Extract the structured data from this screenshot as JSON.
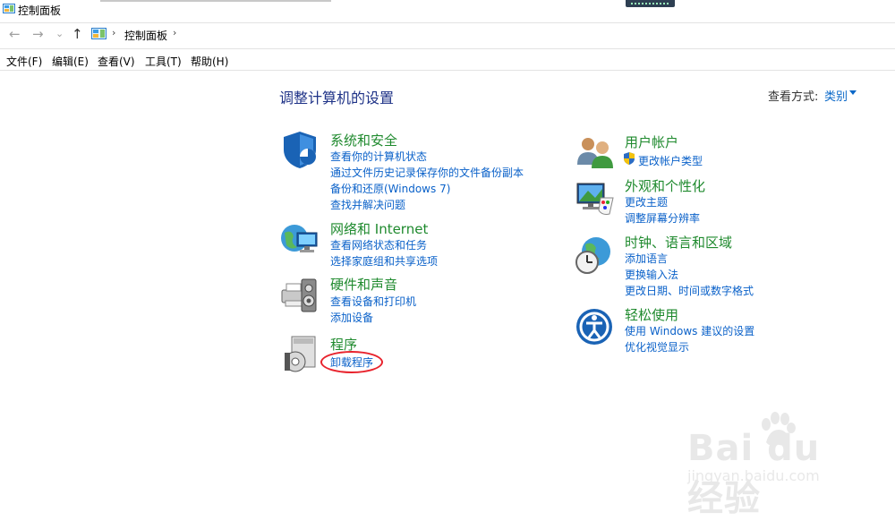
{
  "window": {
    "title": "控制面板"
  },
  "nav": {
    "back": "←",
    "forward": "→",
    "dropdown": "⌄",
    "up": "↑",
    "breadcrumb": "控制面板"
  },
  "menu": [
    "文件(F)",
    "编辑(E)",
    "查看(V)",
    "工具(T)",
    "帮助(H)"
  ],
  "page": {
    "title": "调整计算机的设置",
    "view_by_label": "查看方式:",
    "view_by_value": "类别"
  },
  "categories_left": [
    {
      "title": "系统和安全",
      "icon": "shield-icon",
      "links": [
        "查看你的计算机状态",
        "通过文件历史记录保存你的文件备份副本",
        "备份和还原(Windows 7)",
        "查找并解决问题"
      ]
    },
    {
      "title": "网络和 Internet",
      "icon": "network-globe-icon",
      "links": [
        "查看网络状态和任务",
        "选择家庭组和共享选项"
      ]
    },
    {
      "title": "硬件和声音",
      "icon": "printer-speaker-icon",
      "links": [
        "查看设备和打印机",
        "添加设备"
      ]
    },
    {
      "title": "程序",
      "icon": "programs-disc-icon",
      "links": [
        "卸载程序"
      ]
    }
  ],
  "categories_right": [
    {
      "title": "用户帐户",
      "icon": "users-icon",
      "links": [
        "更改帐户类型"
      ]
    },
    {
      "title": "外观和个性化",
      "icon": "monitor-palette-icon",
      "links": [
        "更改主题",
        "调整屏幕分辨率"
      ]
    },
    {
      "title": "时钟、语言和区域",
      "icon": "globe-clock-icon",
      "links": [
        "添加语言",
        "更换输入法",
        "更改日期、时间或数字格式"
      ]
    },
    {
      "title": "轻松使用",
      "icon": "ease-of-access-icon",
      "links": [
        "使用 Windows 建议的设置",
        "优化视觉显示"
      ]
    }
  ],
  "watermark": {
    "main": "Bai du 经验",
    "sub": "jingyan.baidu.com"
  },
  "colors": {
    "category_title": "#1f8a2e",
    "link": "#0a61c9",
    "page_title": "#1e3287",
    "highlight_oval": "#e8222c"
  }
}
